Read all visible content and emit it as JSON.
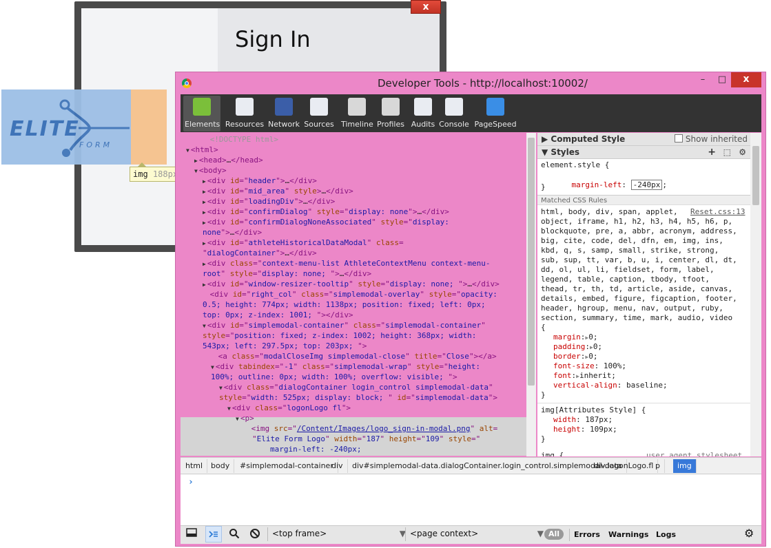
{
  "background_page": {
    "modal_close": "x",
    "title": "Sign In",
    "logo_text_main": "ELITE",
    "logo_text_sub": "FORM",
    "tooltip_tag": "img",
    "tooltip_dim": "188px"
  },
  "devtools": {
    "title": "Developer Tools - http://localhost:10002/",
    "window_buttons": {
      "minimize": "–",
      "maximize": "□",
      "close": "x"
    },
    "toolbar": [
      {
        "label": "Elements",
        "icon": "elements-icon",
        "color": "#7bbf3a"
      },
      {
        "label": "Resources",
        "icon": "resources-icon",
        "color": "#e9ecf2"
      },
      {
        "label": "Network",
        "icon": "network-icon",
        "color": "#3b5ea8"
      },
      {
        "label": "Sources",
        "icon": "sources-icon",
        "color": "#e9ecf2"
      },
      {
        "label": "Timeline",
        "icon": "timeline-icon",
        "color": "#d8d8d8"
      },
      {
        "label": "Profiles",
        "icon": "profiles-icon",
        "color": "#d8d8d8"
      },
      {
        "label": "Audits",
        "icon": "audits-icon",
        "color": "#e9ecf2"
      },
      {
        "label": "Console",
        "icon": "console-icon",
        "color": "#e9ecf2"
      },
      {
        "label": "PageSpeed",
        "icon": "pagespeed-icon",
        "color": "#3a8ee6"
      }
    ],
    "dom_lines": [
      {
        "indent": 2,
        "arrow": "",
        "parts": [
          [
            "cm",
            "<!DOCTYPE html>"
          ]
        ]
      },
      {
        "indent": 0,
        "arrow": "▼",
        "parts": [
          [
            "tag",
            "<html>"
          ]
        ]
      },
      {
        "indent": 1,
        "arrow": "▶",
        "parts": [
          [
            "tag",
            "<head>"
          ],
          [
            "txt",
            "…"
          ],
          [
            "tag",
            "</head>"
          ]
        ]
      },
      {
        "indent": 1,
        "arrow": "▼",
        "parts": [
          [
            "tag",
            "<body>"
          ]
        ]
      },
      {
        "indent": 2,
        "arrow": "▶",
        "parts": [
          [
            "tag",
            "<div "
          ],
          [
            "an",
            "id"
          ],
          [
            "tag",
            "=\""
          ],
          [
            "av",
            "header"
          ],
          [
            "tag",
            "\">"
          ],
          [
            "txt",
            "…"
          ],
          [
            "tag",
            "</div>"
          ]
        ]
      },
      {
        "indent": 2,
        "arrow": "▶",
        "parts": [
          [
            "tag",
            "<div "
          ],
          [
            "an",
            "id"
          ],
          [
            "tag",
            "=\""
          ],
          [
            "av",
            "mid_area"
          ],
          [
            "tag",
            "\" "
          ],
          [
            "an",
            "style"
          ],
          [
            "tag",
            ">"
          ],
          [
            "txt",
            "…"
          ],
          [
            "tag",
            "</div>"
          ]
        ]
      },
      {
        "indent": 2,
        "arrow": "▶",
        "parts": [
          [
            "tag",
            "<div "
          ],
          [
            "an",
            "id"
          ],
          [
            "tag",
            "=\""
          ],
          [
            "av",
            "loadingDiv"
          ],
          [
            "tag",
            "\">"
          ],
          [
            "txt",
            "…"
          ],
          [
            "tag",
            "</div>"
          ]
        ]
      },
      {
        "indent": 2,
        "arrow": "▶",
        "parts": [
          [
            "tag",
            "<div "
          ],
          [
            "an",
            "id"
          ],
          [
            "tag",
            "=\""
          ],
          [
            "av",
            "confirmDialog"
          ],
          [
            "tag",
            "\" "
          ],
          [
            "an",
            "style"
          ],
          [
            "tag",
            "=\""
          ],
          [
            "av",
            "display: none"
          ],
          [
            "tag",
            "\">"
          ],
          [
            "txt",
            "…"
          ],
          [
            "tag",
            "</div>"
          ]
        ]
      },
      {
        "indent": 2,
        "arrow": "▶",
        "parts": [
          [
            "tag",
            "<div "
          ],
          [
            "an",
            "id"
          ],
          [
            "tag",
            "=\""
          ],
          [
            "av",
            "confirmDialogNoneAssociated"
          ],
          [
            "tag",
            "\" "
          ],
          [
            "an",
            "style"
          ],
          [
            "tag",
            "=\""
          ],
          [
            "av",
            "display:"
          ]
        ]
      },
      {
        "indent": 2,
        "arrow": "",
        "cont": true,
        "parts": [
          [
            "av",
            "none"
          ],
          [
            "tag",
            "\">"
          ],
          [
            "txt",
            "…"
          ],
          [
            "tag",
            "</div>"
          ]
        ]
      },
      {
        "indent": 2,
        "arrow": "▶",
        "parts": [
          [
            "tag",
            "<div "
          ],
          [
            "an",
            "id"
          ],
          [
            "tag",
            "=\""
          ],
          [
            "av",
            "athleteHistoricalDataModal"
          ],
          [
            "tag",
            "\" "
          ],
          [
            "an",
            "class"
          ],
          [
            "tag",
            "="
          ]
        ]
      },
      {
        "indent": 2,
        "arrow": "",
        "cont": true,
        "parts": [
          [
            "tag",
            "\""
          ],
          [
            "av",
            "dialogContainer"
          ],
          [
            "tag",
            "\">"
          ],
          [
            "txt",
            "…"
          ],
          [
            "tag",
            "</div>"
          ]
        ]
      },
      {
        "indent": 2,
        "arrow": "▶",
        "parts": [
          [
            "tag",
            "<div "
          ],
          [
            "an",
            "class"
          ],
          [
            "tag",
            "=\""
          ],
          [
            "av",
            "context-menu-list AthleteContextMenu context-menu-"
          ]
        ]
      },
      {
        "indent": 2,
        "arrow": "",
        "cont": true,
        "parts": [
          [
            "av",
            "root"
          ],
          [
            "tag",
            "\" "
          ],
          [
            "an",
            "style"
          ],
          [
            "tag",
            "=\""
          ],
          [
            "av",
            "display: none; "
          ],
          [
            "tag",
            "\">"
          ],
          [
            "txt",
            "…"
          ],
          [
            "tag",
            "</div>"
          ]
        ]
      },
      {
        "indent": 2,
        "arrow": "▶",
        "parts": [
          [
            "tag",
            "<div "
          ],
          [
            "an",
            "id"
          ],
          [
            "tag",
            "=\""
          ],
          [
            "av",
            "window-resizer-tooltip"
          ],
          [
            "tag",
            "\" "
          ],
          [
            "an",
            "style"
          ],
          [
            "tag",
            "=\""
          ],
          [
            "av",
            "display: none; "
          ],
          [
            "tag",
            "\">"
          ],
          [
            "txt",
            "…"
          ],
          [
            "tag",
            "</div>"
          ]
        ]
      },
      {
        "indent": 2,
        "arrow": " ",
        "parts": [
          [
            "tag",
            "<div "
          ],
          [
            "an",
            "id"
          ],
          [
            "tag",
            "=\""
          ],
          [
            "av",
            "right_col"
          ],
          [
            "tag",
            "\" "
          ],
          [
            "an",
            "class"
          ],
          [
            "tag",
            "=\""
          ],
          [
            "av",
            "simplemodal-overlay"
          ],
          [
            "tag",
            "\" "
          ],
          [
            "an",
            "style"
          ],
          [
            "tag",
            "=\""
          ],
          [
            "av",
            "opacity:"
          ]
        ]
      },
      {
        "indent": 2,
        "arrow": "",
        "cont": true,
        "parts": [
          [
            "av",
            "0.5; height: 774px; width: 1138px; position: fixed; left: 0px;"
          ]
        ]
      },
      {
        "indent": 2,
        "arrow": "",
        "cont": true,
        "parts": [
          [
            "av",
            "top: 0px; z-index: 1001; "
          ],
          [
            "tag",
            "\"></div>"
          ]
        ]
      },
      {
        "indent": 2,
        "arrow": "▼",
        "parts": [
          [
            "tag",
            "<div "
          ],
          [
            "an",
            "id"
          ],
          [
            "tag",
            "=\""
          ],
          [
            "av",
            "simplemodal-container"
          ],
          [
            "tag",
            "\" "
          ],
          [
            "an",
            "class"
          ],
          [
            "tag",
            "=\""
          ],
          [
            "av",
            "simplemodal-container"
          ],
          [
            "tag",
            "\""
          ]
        ]
      },
      {
        "indent": 2,
        "arrow": "",
        "cont": true,
        "parts": [
          [
            "an",
            "style"
          ],
          [
            "tag",
            "=\""
          ],
          [
            "av",
            "position: fixed; z-index: 1002; height: 368px; width:"
          ]
        ]
      },
      {
        "indent": 2,
        "arrow": "",
        "cont": true,
        "parts": [
          [
            "av",
            "543px; left: 297.5px; top: 203px; "
          ],
          [
            "tag",
            "\">"
          ]
        ]
      },
      {
        "indent": 3,
        "arrow": " ",
        "parts": [
          [
            "tag",
            "<a "
          ],
          [
            "an",
            "class"
          ],
          [
            "tag",
            "=\""
          ],
          [
            "av",
            "modalCloseImg simplemodal-close"
          ],
          [
            "tag",
            "\" "
          ],
          [
            "an",
            "title"
          ],
          [
            "tag",
            "=\""
          ],
          [
            "av",
            "Close"
          ],
          [
            "tag",
            "\"></a>"
          ]
        ]
      },
      {
        "indent": 3,
        "arrow": "▼",
        "parts": [
          [
            "tag",
            "<div "
          ],
          [
            "an",
            "tabindex"
          ],
          [
            "tag",
            "=\""
          ],
          [
            "av",
            "-1"
          ],
          [
            "tag",
            "\" "
          ],
          [
            "an",
            "class"
          ],
          [
            "tag",
            "=\""
          ],
          [
            "av",
            "simplemodal-wrap"
          ],
          [
            "tag",
            "\" "
          ],
          [
            "an",
            "style"
          ],
          [
            "tag",
            "=\""
          ],
          [
            "av",
            "height:"
          ]
        ]
      },
      {
        "indent": 3,
        "arrow": "",
        "cont": true,
        "parts": [
          [
            "av",
            "100%; outline: 0px; width: 100%; overflow: visible; "
          ],
          [
            "tag",
            "\">"
          ]
        ]
      },
      {
        "indent": 4,
        "arrow": "▼",
        "parts": [
          [
            "tag",
            "<div "
          ],
          [
            "an",
            "class"
          ],
          [
            "tag",
            "=\""
          ],
          [
            "av",
            "dialogContainer login_control simplemodal-data"
          ],
          [
            "tag",
            "\""
          ]
        ]
      },
      {
        "indent": 4,
        "arrow": "",
        "cont": true,
        "parts": [
          [
            "an",
            "style"
          ],
          [
            "tag",
            "=\""
          ],
          [
            "av",
            "width: 525px; display: block; "
          ],
          [
            "tag",
            "\" "
          ],
          [
            "an",
            "id"
          ],
          [
            "tag",
            "=\""
          ],
          [
            "av",
            "simplemodal-data"
          ],
          [
            "tag",
            "\">"
          ]
        ]
      },
      {
        "indent": 5,
        "arrow": "▼",
        "parts": [
          [
            "tag",
            "<div "
          ],
          [
            "an",
            "class"
          ],
          [
            "tag",
            "=\""
          ],
          [
            "av",
            "logonLogo fl"
          ],
          [
            "tag",
            "\">"
          ]
        ]
      },
      {
        "indent": 6,
        "arrow": "▼",
        "parts": [
          [
            "tag",
            "<p>"
          ]
        ]
      },
      {
        "indent": 7,
        "arrow": " ",
        "parts": [
          [
            "tag",
            "<img "
          ],
          [
            "an",
            "src"
          ],
          [
            "tag",
            "=\""
          ],
          [
            "lnk",
            "/Content/Images/logo_sign-in-modal.png"
          ],
          [
            "tag",
            "\" "
          ],
          [
            "an",
            "alt"
          ],
          [
            "tag",
            "="
          ]
        ]
      },
      {
        "indent": 7,
        "arrow": "",
        "cont": true,
        "parts": [
          [
            "tag",
            "\""
          ],
          [
            "av",
            "Elite Form Logo"
          ],
          [
            "tag",
            "\" "
          ],
          [
            "an",
            "width"
          ],
          [
            "tag",
            "=\""
          ],
          [
            "av",
            "187"
          ],
          [
            "tag",
            "\" "
          ],
          [
            "an",
            "height"
          ],
          [
            "tag",
            "=\""
          ],
          [
            "av",
            "109"
          ],
          [
            "tag",
            "\" "
          ],
          [
            "an",
            "style"
          ],
          [
            "tag",
            "=\""
          ]
        ]
      },
      {
        "indent": 9,
        "arrow": "",
        "cont": true,
        "parts": [
          [
            "av",
            "margin-left: -240px;"
          ]
        ]
      },
      {
        "indent": 7,
        "arrow": "",
        "cont": true,
        "parts": [
          [
            "tag",
            "\">"
          ]
        ]
      }
    ],
    "styles": {
      "computed_header": "Computed Style",
      "show_inherited": "Show inherited",
      "styles_header": "Styles",
      "element_style_selector": "element.style {",
      "element_style_prop": "margin-left",
      "element_style_value": "-240px",
      "close_brace": "}",
      "matched_header": "Matched CSS Rules",
      "reset_link": "Reset.css:13",
      "reset_selector_lines": [
        "html, body, div, span, applet,",
        "object, iframe, h1, h2, h3, h4, h5, h6, p,",
        "blockquote, pre, a, abbr, acronym, address,",
        "big, cite, code, del, dfn, em, img, ins,",
        "kbd, q, s, samp, small, strike, strong,",
        "sub, sup, tt, var, b, u, i, center, dl, dt,",
        "dd, ol, ul, li, fieldset, form, label,",
        "legend, table, caption, tbody, tfoot,",
        "thead, tr, th, td, article, aside, canvas,",
        "details, embed, figure, figcaption, footer,",
        "header, hgroup, menu, nav, output, ruby,",
        "section, summary, time, mark, audio, video",
        "{"
      ],
      "reset_props": [
        {
          "name": "margin",
          "value": "0",
          "tri": true
        },
        {
          "name": "padding",
          "value": "0",
          "tri": true
        },
        {
          "name": "border",
          "value": "0",
          "tri": true
        },
        {
          "name": "font-size",
          "value": "100%",
          "tri": false
        },
        {
          "name": "font",
          "value": "inherit",
          "tri": true
        },
        {
          "name": "vertical-align",
          "value": "baseline",
          "tri": false
        }
      ],
      "attr_selector": "img[Attributes Style] {",
      "attr_props": [
        {
          "name": "width",
          "value": "187px"
        },
        {
          "name": "height",
          "value": "109px"
        }
      ],
      "ua_selector": "img {",
      "ua_label": "user agent stylesheet"
    },
    "breadcrumb": [
      "html",
      "body",
      "#simplemodal-container",
      "div",
      "div#simplemodal-data.dialogContainer.login_control.simplemodal-data",
      "div.logonLogo.fl",
      "p",
      "img"
    ],
    "console_prompt": "›",
    "statusbar": {
      "frame_select": "<top frame>",
      "context_select": "<page context>",
      "filter_all": "All",
      "filter_errors": "Errors",
      "filter_warnings": "Warnings",
      "filter_logs": "Logs"
    }
  }
}
